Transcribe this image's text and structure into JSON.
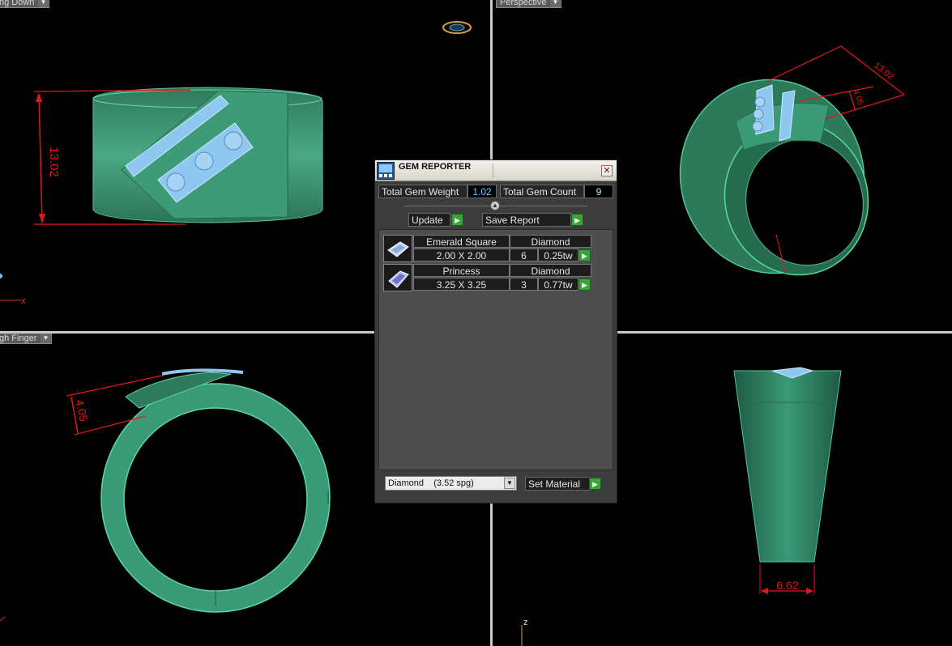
{
  "viewports": {
    "top_left": {
      "label": "ng Down"
    },
    "top_right": {
      "label": "Perspective"
    },
    "bottom_left": {
      "label": "gh Finger"
    },
    "bottom_right": {
      "label": ""
    }
  },
  "dimensions": {
    "height": "13.02",
    "perspective_width": "13.02",
    "perspective_depth": "4.05",
    "finger_depth": "4.05",
    "bottom_width": "6.62"
  },
  "axis_labels": {
    "x": "x",
    "z": "z"
  },
  "gem_reporter": {
    "title": "GEM REPORTER",
    "close": "✕",
    "total_weight_label": "Total Gem Weight",
    "total_weight_value": "1.02",
    "total_count_label": "Total Gem Count",
    "total_count_value": "9",
    "update_label": "Update",
    "save_label": "Save Report",
    "gems": [
      {
        "shape": "Emerald Square",
        "material": "Diamond",
        "size": "2.00 X 2.00",
        "count": "6",
        "weight": "0.25tw"
      },
      {
        "shape": "Princess",
        "material": "Diamond",
        "size": "3.25 X 3.25",
        "count": "3",
        "weight": "0.77tw"
      }
    ],
    "material_select": "Diamond    (3.52 spg)",
    "set_material_label": "Set Material"
  },
  "colors": {
    "ring_fill": "#3a9a78",
    "dimension": "#e01818",
    "gem": "#8ec8f0"
  }
}
